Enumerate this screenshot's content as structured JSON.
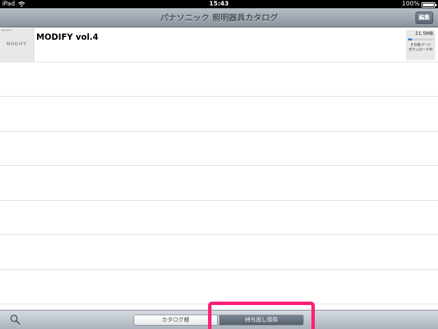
{
  "status_bar": {
    "device": "iPad",
    "time": "15:43",
    "battery": "100%"
  },
  "nav": {
    "title": "パナソニック 照明器具カタログ",
    "edit_label": "編集"
  },
  "list": {
    "items": [
      {
        "title": "MODIFY vol.4",
        "thumbnail_text": "MODIFY",
        "thumbnail_small": "Panasonic",
        "size": "21.5MB",
        "progress": 0.15,
        "status": "その他ページ\nダウンロード中"
      }
    ]
  },
  "toolbar": {
    "tab_catalog": "カタログ棚",
    "tab_saved": "持ち出し保存",
    "selected": "tab_saved"
  },
  "colors": {
    "highlight": "#ff1f77",
    "progress": "#3a7fd8"
  }
}
